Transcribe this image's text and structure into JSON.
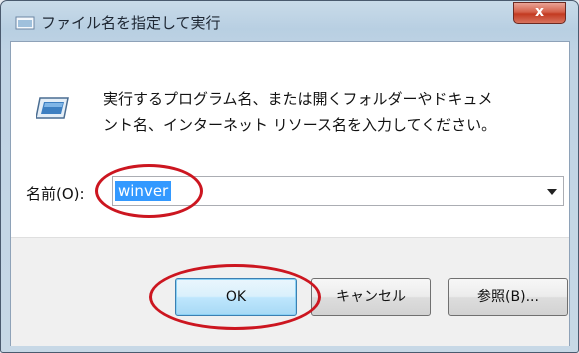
{
  "window": {
    "title": "ファイル名を指定して実行",
    "close_label": "x",
    "title_icon": "run-window-icon"
  },
  "content": {
    "icon": "run-program-icon",
    "description": "実行するプログラム名、または開くフォルダーやドキュメ\nント名、インターネット リソース名を入力してください。"
  },
  "input": {
    "label": "名前(O):",
    "value": "winver",
    "dropdown_icon": "chevron-down-icon"
  },
  "buttons": {
    "ok": "OK",
    "cancel": "キャンセル",
    "browse": "参照(B)..."
  },
  "annotations": {
    "color": "#cc1620",
    "highlighted": [
      "input-value",
      "ok-button"
    ]
  }
}
